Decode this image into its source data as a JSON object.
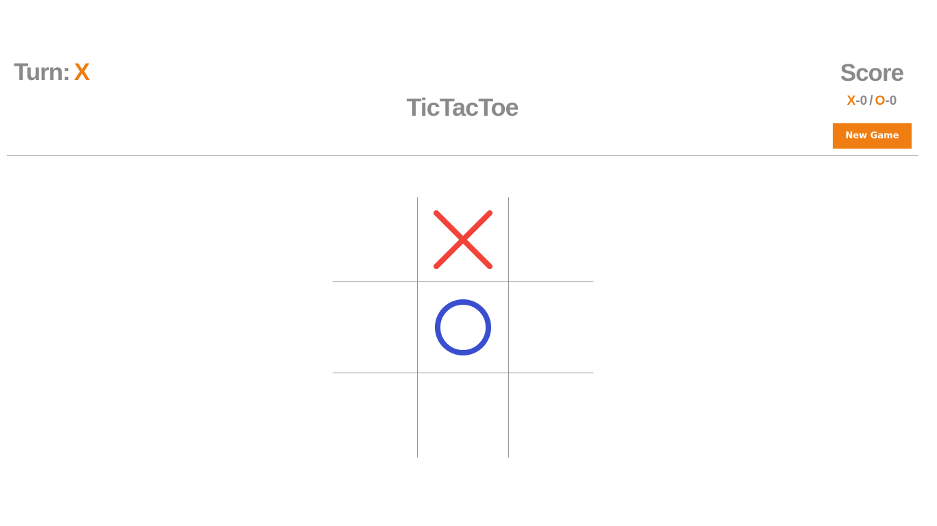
{
  "header": {
    "turn_label": "Turn:",
    "turn_value": "X",
    "title": "TicTacToe"
  },
  "score": {
    "title": "Score",
    "x_label": "X",
    "x_value": "-0",
    "separator": "/",
    "o_label": "O",
    "o_value": "-0",
    "new_game_label": "New Game"
  },
  "board": {
    "cells": [
      "",
      "X",
      "",
      "",
      "O",
      "",
      "",
      "",
      ""
    ]
  },
  "colors": {
    "accent": "#ef7d11",
    "text_gray": "#8a8a8a",
    "x_mark": "#f2433a",
    "o_mark": "#3a4fcf",
    "grid": "#8f8f8f"
  },
  "icons": {
    "x_mark": "x-mark-icon",
    "o_mark": "o-mark-icon"
  }
}
